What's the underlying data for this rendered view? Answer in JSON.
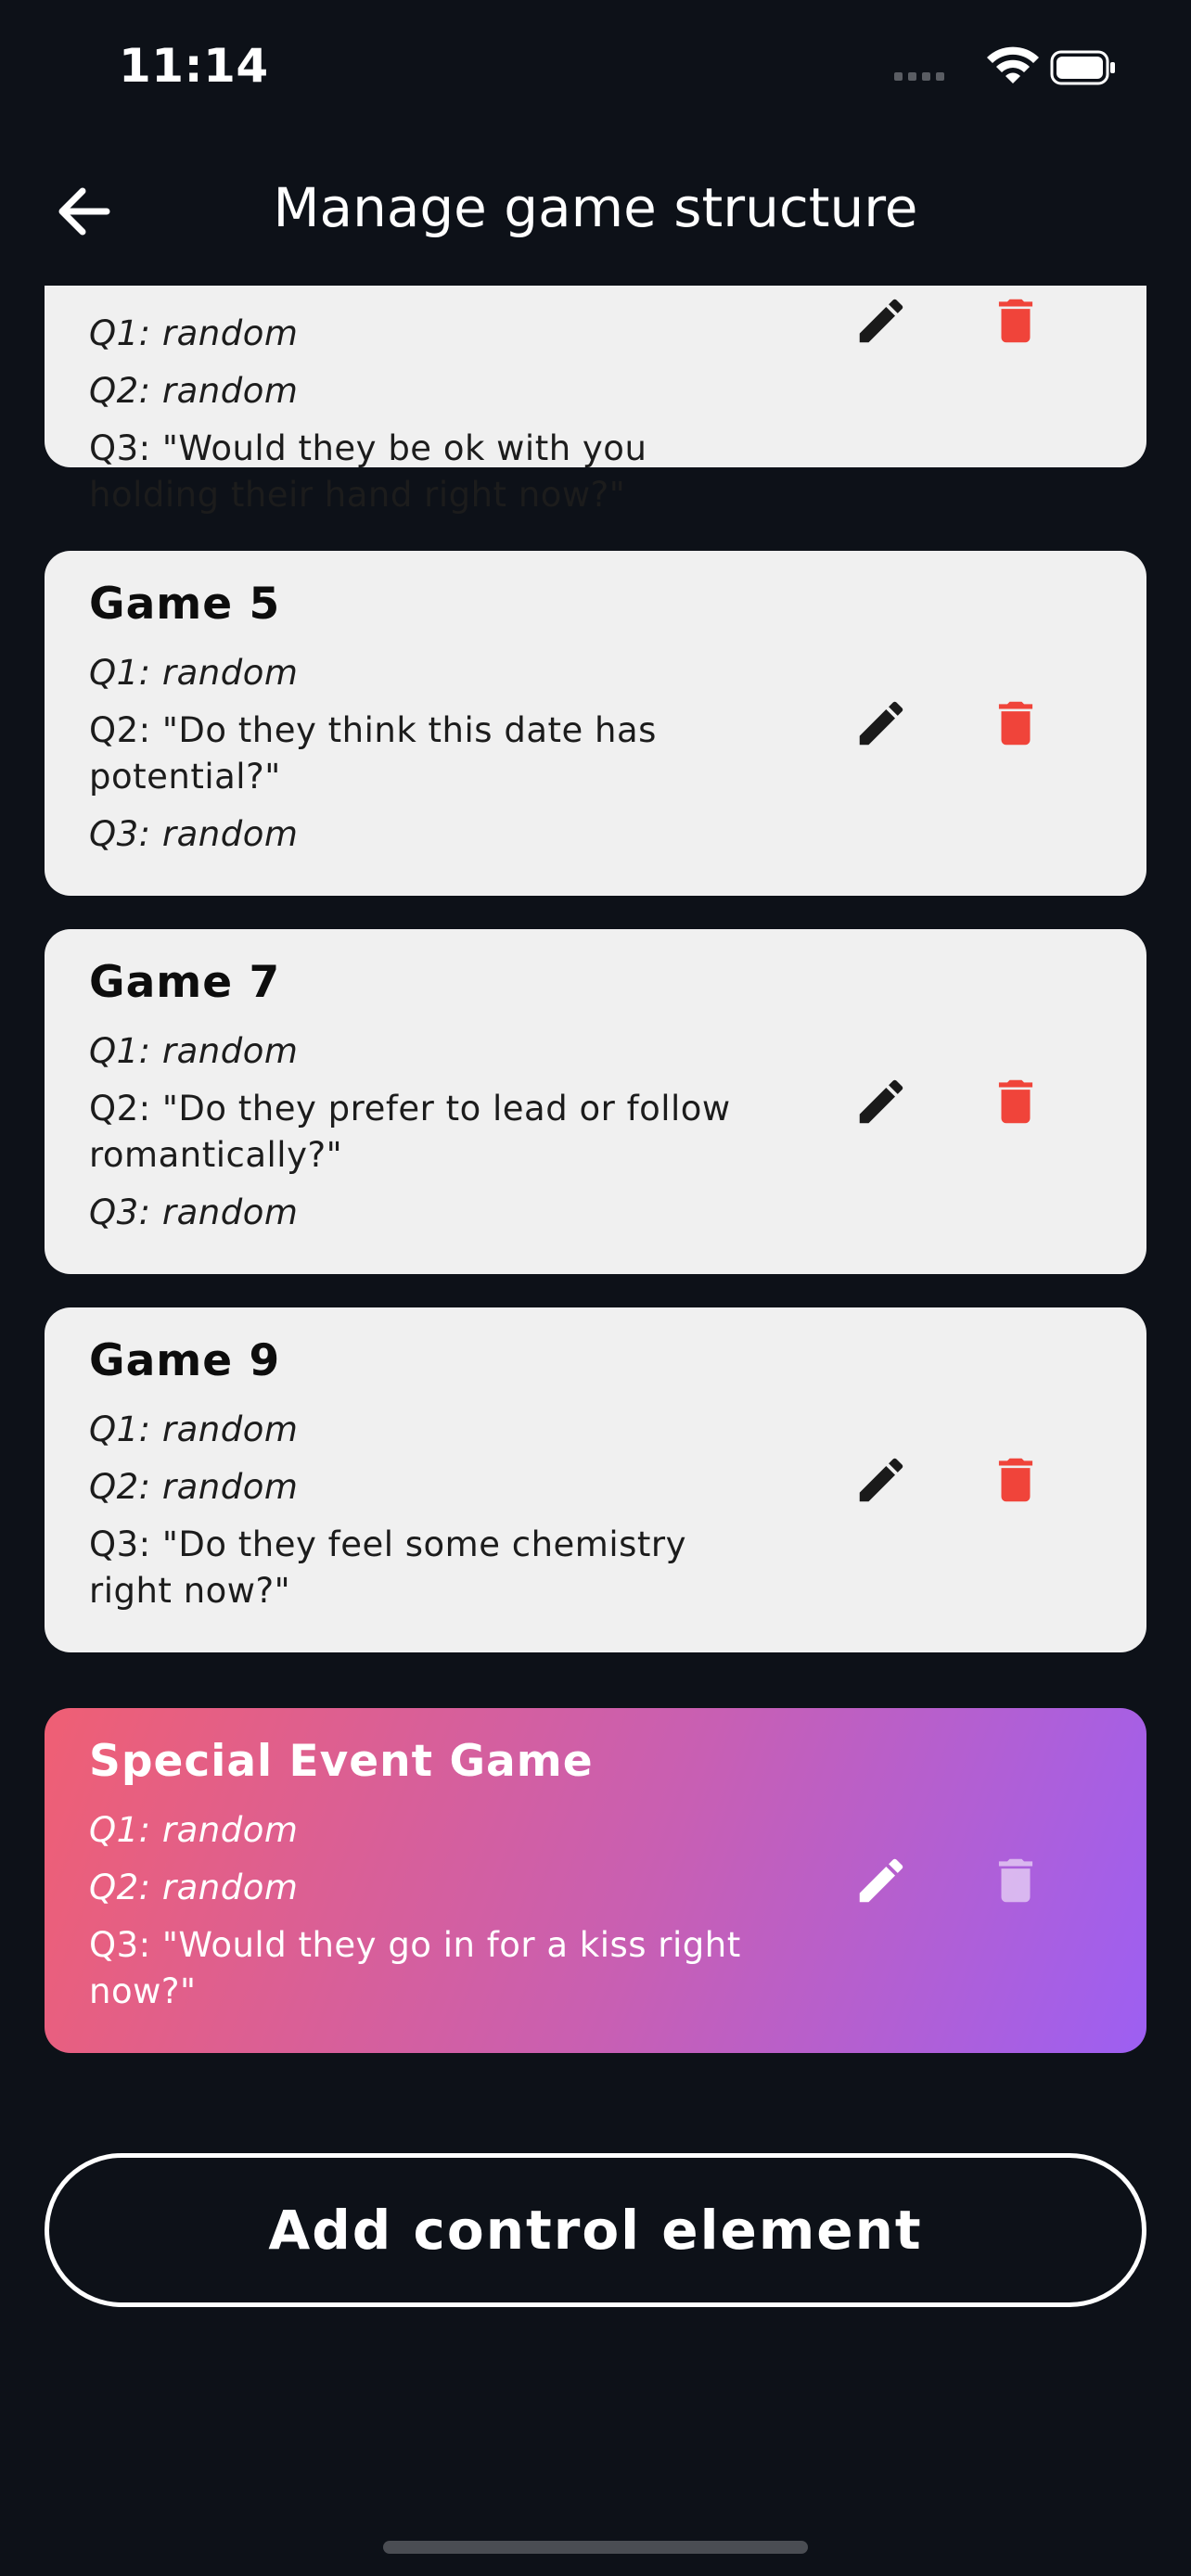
{
  "status_bar": {
    "time": "11:14",
    "icons": [
      "signal-icon",
      "wifi-icon",
      "battery-icon"
    ]
  },
  "header": {
    "back_icon": "arrow-left-icon",
    "title": "Manage game structure"
  },
  "cards": [
    {
      "title": "",
      "q1": "Q1: random",
      "q2": "Q2: random",
      "q3": "Q3: \"Would they be ok with you holding their hand right now?\""
    },
    {
      "title": "Game 5",
      "q1": "Q1: random",
      "q2": "Q2: \"Do they think this date has potential?\"",
      "q3": "Q3: random"
    },
    {
      "title": "Game 7",
      "q1": "Q1: random",
      "q2": "Q2: \"Do they prefer to lead or follow romantically?\"",
      "q3": "Q3: random"
    },
    {
      "title": "Game 9",
      "q1": "Q1: random",
      "q2": "Q2: random",
      "q3": "Q3: \"Do they feel some chemistry right now?\""
    },
    {
      "title": "Special Event Game",
      "q1": "Q1: random",
      "q2": "Q2: random",
      "q3": "Q3: \"Would they go in for a kiss right now?\""
    }
  ],
  "actions": {
    "edit_icon": "pencil-icon",
    "delete_icon": "trash-icon"
  },
  "add_button": {
    "label": "Add control element"
  },
  "colors": {
    "background": "#0d1118",
    "card": "#f0f0f0",
    "delete_red": "#f0443a",
    "special_gradient_start": "#ef5f74",
    "special_gradient_end": "#9d5ff2"
  }
}
